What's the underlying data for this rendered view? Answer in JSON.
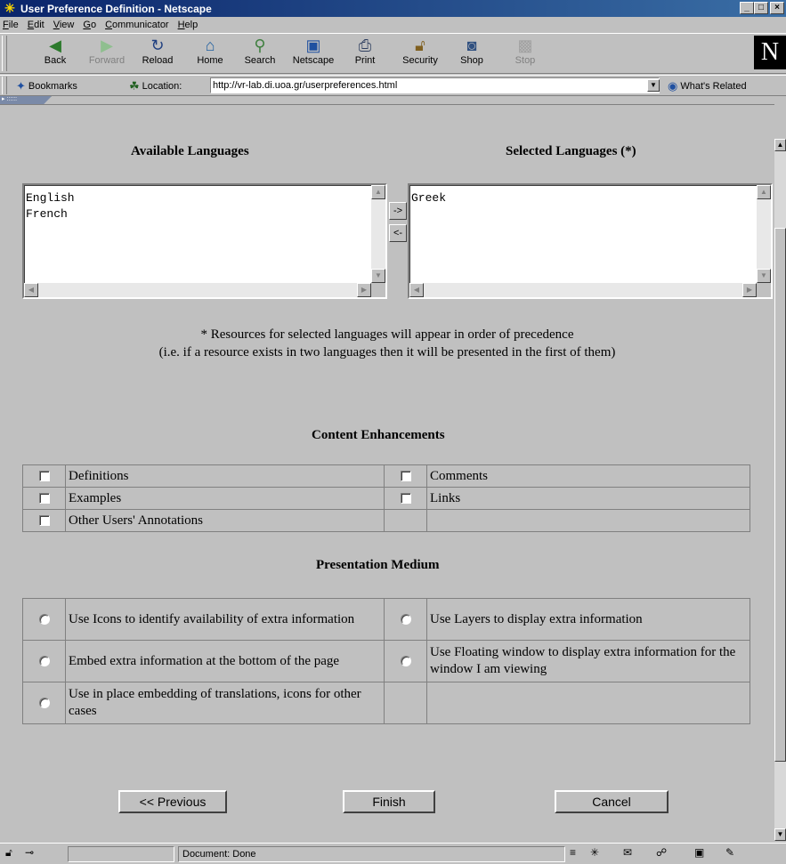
{
  "window": {
    "title": "User Preference Definition - Netscape",
    "minimize_label": "_",
    "maximize_label": "□",
    "close_label": "×"
  },
  "menu": [
    "File",
    "Edit",
    "View",
    "Go",
    "Communicator",
    "Help"
  ],
  "toolbar": {
    "buttons": [
      {
        "label": "Back",
        "icon": "back-arrow-icon"
      },
      {
        "label": "Forward",
        "icon": "forward-arrow-icon"
      },
      {
        "label": "Reload",
        "icon": "reload-icon"
      },
      {
        "label": "Home",
        "icon": "home-icon"
      },
      {
        "label": "Search",
        "icon": "search-icon"
      },
      {
        "label": "Netscape",
        "icon": "netscape-icon"
      },
      {
        "label": "Print",
        "icon": "print-icon"
      },
      {
        "label": "Security",
        "icon": "lock-icon"
      },
      {
        "label": "Shop",
        "icon": "shop-icon"
      },
      {
        "label": "Stop",
        "icon": "stop-icon"
      }
    ],
    "logo": "N"
  },
  "location": {
    "bookmarks_label": "Bookmarks",
    "location_label": "Location:",
    "url": "http://vr-lab.di.uoa.gr/userpreferences.html",
    "whats_related_label": "What's Related"
  },
  "languages": {
    "available_heading": "Available Languages",
    "selected_heading": "Selected Languages (*)",
    "available": [
      "English",
      "French"
    ],
    "selected": [
      "Greek"
    ],
    "add_button": "->",
    "remove_button": "<-",
    "note_line1": "* Resources for selected languages will appear in order of precedence",
    "note_line2": "(i.e. if a resource exists in two languages then it will be presented in the first of them)"
  },
  "content_enhancements": {
    "heading": "Content Enhancements",
    "rows": [
      [
        "Definitions",
        "Comments"
      ],
      [
        "Examples",
        "Links"
      ],
      [
        "Other Users' Annotations",
        ""
      ]
    ]
  },
  "presentation_medium": {
    "heading": "Presentation Medium",
    "rows": [
      [
        "Use Icons to identify availability of extra information",
        "Use Layers to display extra information"
      ],
      [
        "Embed extra information at the bottom of the page",
        "Use Floating window to display extra information for the window I am viewing"
      ],
      [
        "Use in place embedding of translations, icons for other cases",
        ""
      ]
    ]
  },
  "buttons": {
    "previous": "<< Previous",
    "finish": "Finish",
    "cancel": "Cancel"
  },
  "status": {
    "text": "Document: Done"
  }
}
